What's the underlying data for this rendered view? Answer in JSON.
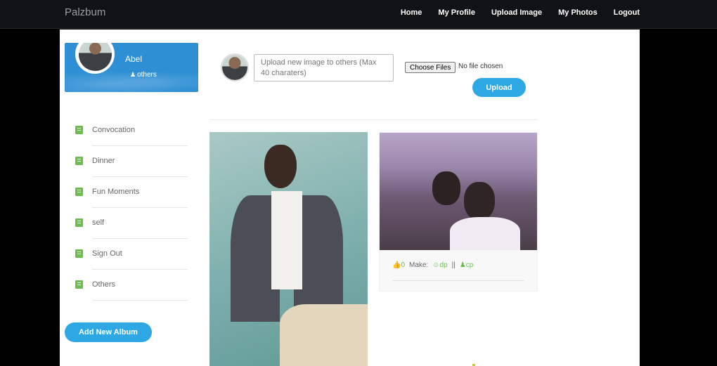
{
  "app": {
    "brand": "Palzbum"
  },
  "nav": {
    "items": [
      {
        "label": "Home"
      },
      {
        "label": "My Profile"
      },
      {
        "label": "Upload Image"
      },
      {
        "label": "My Photos"
      },
      {
        "label": "Logout"
      }
    ]
  },
  "profile": {
    "name": "Abel",
    "group": "others"
  },
  "albums": {
    "items": [
      {
        "label": "Convocation"
      },
      {
        "label": "Dinner"
      },
      {
        "label": "Fun Moments"
      },
      {
        "label": "self"
      },
      {
        "label": "Sign Out"
      },
      {
        "label": "Others"
      }
    ],
    "add_label": "Add New Album"
  },
  "upload": {
    "placeholder": "Upload new image to others (Max 40 charaters)",
    "file_button": "Choose Files",
    "file_status": "No file chosen",
    "submit_label": "Upload"
  },
  "card": {
    "likes": "0",
    "make_label": "Make:",
    "dp_label": "dp",
    "sep": "||",
    "cp_label": "cp"
  },
  "colors": {
    "accent": "#2da8e4",
    "green": "#6abf4b",
    "navbar": "#111214"
  }
}
